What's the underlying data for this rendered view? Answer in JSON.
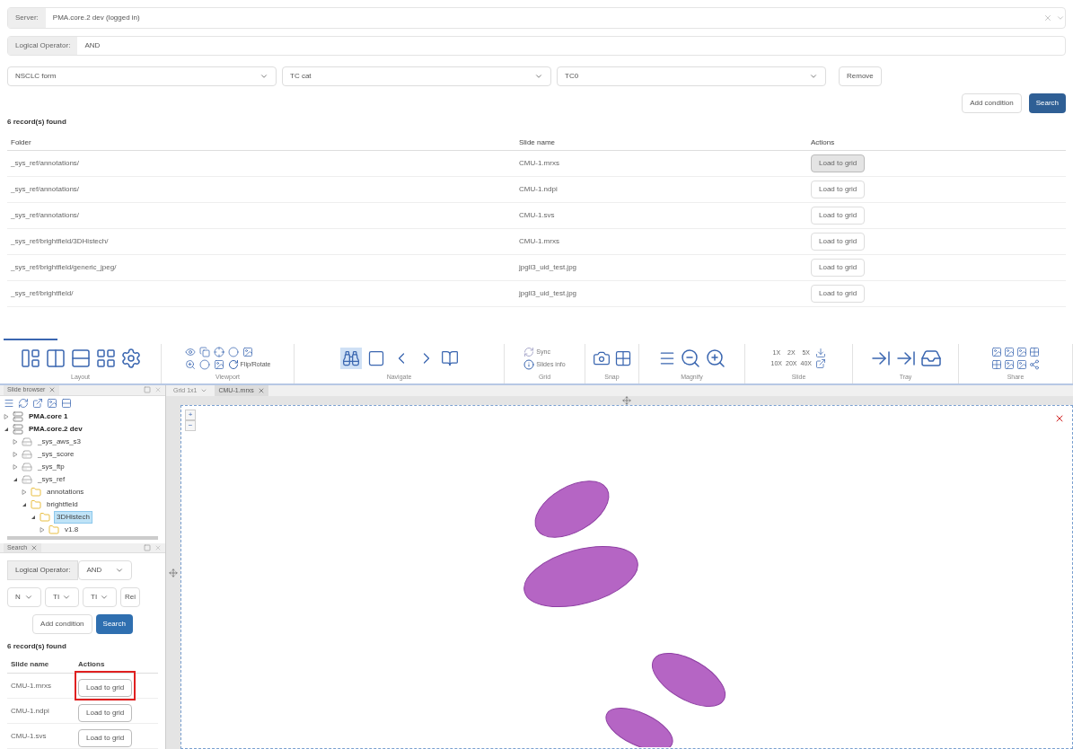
{
  "server": {
    "label": "Server:",
    "value": "PMA.core.2 dev (logged in)"
  },
  "logical_operator": {
    "label": "Logical Operator:",
    "value": "AND"
  },
  "conditions": [
    {
      "field": "NSCLC form",
      "category": "TC cat",
      "value": "TC0",
      "remove": "Remove"
    }
  ],
  "actions": {
    "add": "Add condition",
    "search": "Search"
  },
  "results": {
    "count": "6 record(s) found",
    "columns": [
      "Folder",
      "Slide name",
      "Actions"
    ],
    "rows": [
      {
        "folder": "_sys_ref/annotations/",
        "slide": "CMU-1.mrxs",
        "action": "Load to grid",
        "hovered": true
      },
      {
        "folder": "_sys_ref/annotations/",
        "slide": "CMU-1.ndpi",
        "action": "Load to grid",
        "hovered": false
      },
      {
        "folder": "_sys_ref/annotations/",
        "slide": "CMU-1.svs",
        "action": "Load to grid",
        "hovered": false
      },
      {
        "folder": "_sys_ref/brightfield/3DHistech/",
        "slide": "CMU-1.mrxs",
        "action": "Load to grid",
        "hovered": false
      },
      {
        "folder": "_sys_ref/brightfield/generic_jpeg/",
        "slide": "jpgll3_uid_test.jpg",
        "action": "Load to grid",
        "hovered": false
      },
      {
        "folder": "_sys_ref/brightfield/",
        "slide": "jpgll3_uid_test.jpg",
        "action": "Load to grid",
        "hovered": false
      }
    ]
  },
  "ribbon": {
    "layout": "Layout",
    "viewport": {
      "label": "Viewport",
      "flip": "Flip/Rotate"
    },
    "navigate": {
      "label": "Navigate",
      "tools": [
        {
          "selected": true
        },
        {
          "selected": false
        },
        {
          "selected": false
        },
        {
          "selected": false
        }
      ]
    },
    "grid": {
      "label": "Grid",
      "sync": "Sync",
      "info": "Slides info"
    },
    "snap": "Snap",
    "magnify": "Magnify",
    "slide": {
      "label": "Slide",
      "zooms": [
        "1X",
        "2X",
        "5X",
        "10X",
        "20X",
        "40X"
      ]
    },
    "tray": "Tray",
    "share": "Share"
  },
  "slide_browser": {
    "tab": "Slide browser",
    "tree": [
      {
        "label": "PMA.core 1",
        "kind": "server",
        "expanded": false,
        "selected": false
      },
      {
        "label": "PMA.core.2 dev",
        "kind": "server",
        "expanded": true,
        "selected": false,
        "children": [
          {
            "label": "_sys_aws_s3",
            "kind": "drive",
            "expanded": false,
            "selected": false
          },
          {
            "label": "_sys_score",
            "kind": "drive",
            "expanded": false,
            "selected": false
          },
          {
            "label": "_sys_ftp",
            "kind": "drive",
            "expanded": false,
            "selected": false
          },
          {
            "label": "_sys_ref",
            "kind": "drive",
            "expanded": true,
            "selected": false,
            "children": [
              {
                "label": "annotations",
                "kind": "folder",
                "expanded": false,
                "selected": false
              },
              {
                "label": "brightfield",
                "kind": "folder",
                "expanded": true,
                "selected": false,
                "children": [
                  {
                    "label": "3DHistech",
                    "kind": "folder",
                    "expanded": true,
                    "selected": true,
                    "children": [
                      {
                        "label": "v1.8",
                        "kind": "folder",
                        "expanded": false,
                        "selected": false
                      }
                    ]
                  }
                ]
              }
            ]
          }
        ]
      }
    ]
  },
  "search_panel": {
    "tab": "Search",
    "operator_label": "Logical Operator:",
    "operator": "AND",
    "selects": [
      "N",
      "TI",
      "TI"
    ],
    "remove": "Rei",
    "add": "Add condition",
    "search": "Search",
    "count": "6 record(s) found",
    "columns": [
      "Slide name",
      "Actions"
    ],
    "rows": [
      {
        "slide": "CMU-1.mrxs",
        "action": "Load to grid",
        "highlighted": true
      },
      {
        "slide": "CMU-1.ndpi",
        "action": "Load to grid",
        "highlighted": false
      },
      {
        "slide": "CMU-1.svs",
        "action": "Load to grid",
        "highlighted": false
      }
    ]
  },
  "viewer": {
    "tabs": [
      {
        "label": "Grid 1x1",
        "selected": false
      },
      {
        "label": "CMU-1.mrxs",
        "selected": true
      }
    ],
    "zoom_in": "+",
    "zoom_out": "−"
  }
}
